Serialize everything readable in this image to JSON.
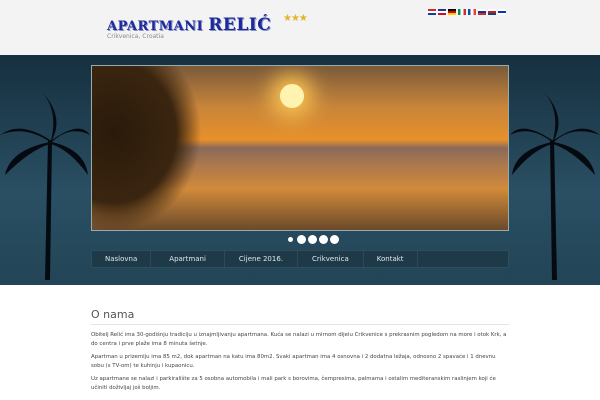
{
  "header": {
    "logo_word1": "APARTMANI",
    "logo_word2": "RELIĆ",
    "stars": "★★★",
    "subtitle": "Crikvenica, Croatia",
    "flags": [
      {
        "name": "croatian",
        "colors": [
          "#d52b1e",
          "#ffffff",
          "#1a3a9a"
        ]
      },
      {
        "name": "english",
        "colors": [
          "#1a3a8a",
          "#ffffff",
          "#c8102e"
        ]
      },
      {
        "name": "german",
        "colors": [
          "#000000",
          "#dd0000",
          "#ffce00"
        ]
      },
      {
        "name": "italian",
        "colors": [
          "#009246",
          "#ffffff",
          "#ce2b37"
        ]
      },
      {
        "name": "french",
        "colors": [
          "#0055a4",
          "#ffffff",
          "#ef4135"
        ]
      },
      {
        "name": "russian",
        "colors": [
          "#ffffff",
          "#0039a6",
          "#d52b1e"
        ]
      },
      {
        "name": "czech",
        "colors": [
          "#ffffff",
          "#d7141a",
          "#11457e"
        ]
      },
      {
        "name": "hebrew",
        "colors": [
          "#ffffff",
          "#0038b8",
          "#ffffff"
        ]
      }
    ]
  },
  "slider": {
    "slide_count": 5,
    "active_index": 0
  },
  "nav": [
    "Naslovna",
    "Apartmani",
    "Cijene 2016.",
    "Crikvenica",
    "Kontakt"
  ],
  "content": {
    "heading": "O nama",
    "paragraphs": [
      "Obitelj Relić ima 30-godišnju tradiciju u iznajmljivanju apartmana. Kuća se nalazi u mirnom dijelu Crikvenice s prekrasnim pogledom na more i otok Krk, a do centra i prve plaže ima 8 minuta šetnje.",
      "Apartman u prizemlju ima 85 m2, dok apartman na katu ima 80m2. Svaki apartman ima 4 osnovna i 2 dodatna ležaja, odnosno 2 spavaće i 1 dnevnu sobu (s TV-om) te kuhinju i kupaonicu.",
      "Uz apartmane se nalazi i parkiralište za 5 osobna automobila i mali park s borovima, čempresima, palmama i ostalim mediteranskim raslinjem koji će učiniti doživljaj još boljim."
    ]
  }
}
